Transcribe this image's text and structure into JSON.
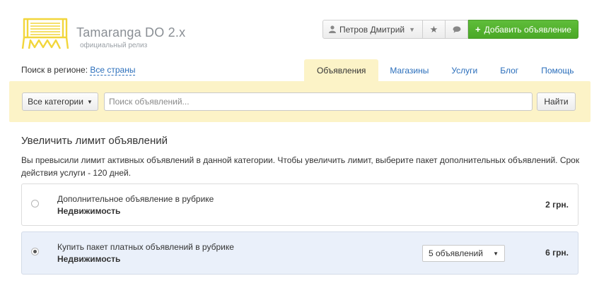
{
  "brand": {
    "title": "Tamaranga DO 2.x",
    "subtitle": "официальный релиз",
    "logo_color": "#f2d63b"
  },
  "topbar": {
    "user_label": "Петров Дмитрий",
    "add_label": "Добавить объявление",
    "accent": "#55b532",
    "icons": [
      "user-icon",
      "star-icon",
      "chat-icon",
      "plus-icon"
    ]
  },
  "region": {
    "label": "Поиск в регионе:",
    "value": "Все страны"
  },
  "tabs": [
    {
      "label": "Объявления",
      "active": true
    },
    {
      "label": "Магазины",
      "active": false
    },
    {
      "label": "Услуги",
      "active": false
    },
    {
      "label": "Блог",
      "active": false
    },
    {
      "label": "Помощь",
      "active": false
    }
  ],
  "search": {
    "category_label": "Все категории",
    "placeholder": "Поиск объявлений...",
    "value": "",
    "button_label": "Найти",
    "band_color": "#fcf3c7"
  },
  "main": {
    "title": "Увеличить лимит объявлений",
    "description": "Вы превысили лимит активных объявлений в данной категории. Чтобы увеличить лимит, выберите пакет дополнительных объявлений. Срок действия услуги - 120 дней.",
    "options": [
      {
        "label": "Дополнительное объявление в рубрике",
        "category": "Недвижимость",
        "price": "2 грн.",
        "selected": false
      },
      {
        "label": "Купить пакет платных объявлений в рубрике",
        "category": "Недвижимость",
        "package": "5 объявлений",
        "price": "6 грн.",
        "selected": true
      }
    ]
  }
}
